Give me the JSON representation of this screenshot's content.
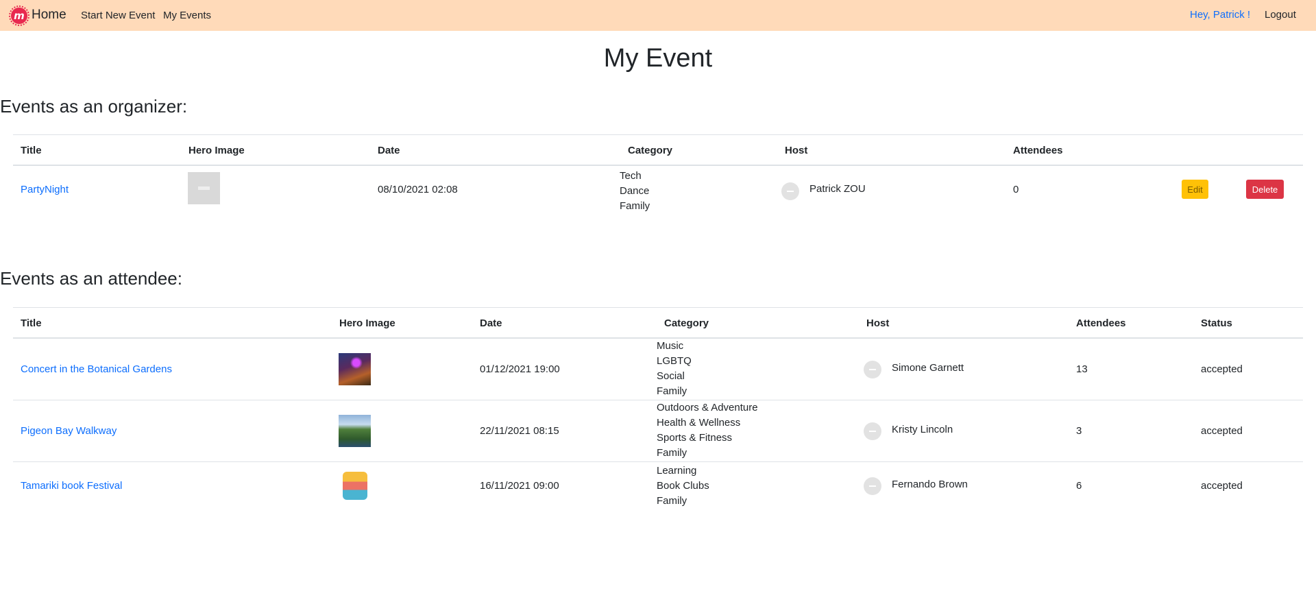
{
  "nav": {
    "logo_letter": "m",
    "brand": "Home",
    "start_new_event": "Start New Event",
    "my_events": "My Events",
    "greeting": "Hey, Patrick !",
    "logout": "Logout"
  },
  "page_title": "My Event",
  "organizer": {
    "heading": "Events as an organizer:",
    "columns": [
      "Title",
      "Hero Image",
      "Date",
      "Category",
      "Host",
      "Attendees"
    ],
    "rows": [
      {
        "title": "PartyNight",
        "date": "08/10/2021 02:08",
        "categories": [
          "Tech",
          "Dance",
          "Family"
        ],
        "host": "Patrick ZOU",
        "attendees": "0",
        "edit_label": "Edit",
        "delete_label": "Delete"
      }
    ]
  },
  "attendee": {
    "heading": "Events as an attendee:",
    "columns": [
      "Title",
      "Hero Image",
      "Date",
      "Category",
      "Host",
      "Attendees",
      "Status"
    ],
    "rows": [
      {
        "title": "Concert in the Botanical Gardens",
        "date": "01/12/2021 19:00",
        "categories": [
          "Music",
          "LGBTQ",
          "Social",
          "Family"
        ],
        "host": "Simone Garnett",
        "attendees": "13",
        "status": "accepted"
      },
      {
        "title": "Pigeon Bay Walkway",
        "date": "22/11/2021 08:15",
        "categories": [
          "Outdoors & Adventure",
          "Health & Wellness",
          "Sports & Fitness",
          "Family"
        ],
        "host": "Kristy Lincoln",
        "attendees": "3",
        "status": "accepted"
      },
      {
        "title": "Tamariki book Festival",
        "date": "16/11/2021 09:00",
        "categories": [
          "Learning",
          "Book Clubs",
          "Family"
        ],
        "host": "Fernando Brown",
        "attendees": "6",
        "status": "accepted"
      }
    ]
  },
  "colors": {
    "navbar_bg": "#ffdab9",
    "link": "#0d6efd",
    "edit_button": "#ffc107",
    "delete_button": "#dc3545",
    "logo": "#e8294f"
  }
}
